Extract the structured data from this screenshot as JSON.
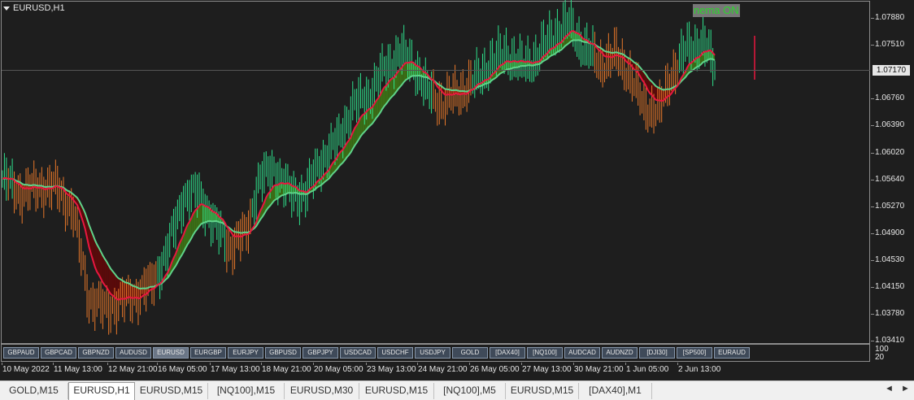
{
  "window": {
    "title": "EURUSD,H1"
  },
  "badge": {
    "label": "nema ON"
  },
  "price_axis": {
    "labels": [
      "1.07880",
      "1.07510",
      "1.07170",
      "1.06760",
      "1.06390",
      "1.06020",
      "1.05640",
      "1.05270",
      "1.04900",
      "1.04530",
      "1.04150",
      "1.03780",
      "1.03410"
    ],
    "current": "1.07170"
  },
  "time_axis": {
    "labels": [
      "10 May 2022",
      "11 May 13:00",
      "12 May 21:00",
      "16 May 05:00",
      "17 May 13:00",
      "18 May 21:00",
      "20 May 05:00",
      "23 May 13:00",
      "24 May 21:00",
      "26 May 05:00",
      "27 May 13:00",
      "30 May 21:00",
      "1 Jun 05:00",
      "2 Jun 13:00"
    ]
  },
  "symbol_buttons": [
    "GBPAUD",
    "GBPCAD",
    "GBPNZD",
    "AUDUSD",
    "EURUSD",
    "EURGBP",
    "EURJPY",
    "GBPUSD",
    "GBPJPY",
    "USDCAD",
    "USDCHF",
    "USDJPY",
    "GOLD",
    "[DAX40]",
    "[NQ100]",
    "AUDCAD",
    "AUDNZD",
    "[DJI30]",
    "[SP500]",
    "EURAUD"
  ],
  "active_symbol": "EURUSD",
  "subwindow_scale": [
    "100",
    "20"
  ],
  "tabs": [
    "GOLD,M15",
    "EURUSD,H1",
    "EURUSD,M15",
    "[NQ100],M15",
    "EURUSD,M30",
    "EURUSD,M15",
    "[NQ100],M5",
    "EURUSD,M15",
    "[DAX40],M1"
  ],
  "active_tab": "EURUSD,H1",
  "scroll": {
    "left": "◄",
    "right": "►"
  },
  "colors": {
    "bull": "#2ee08c",
    "bear": "#e8782a",
    "bull_band": "#3b6e16",
    "bear_band": "#5a0a0a",
    "fast_line": "#e8173f",
    "slow_line": "#5fd38a"
  }
}
